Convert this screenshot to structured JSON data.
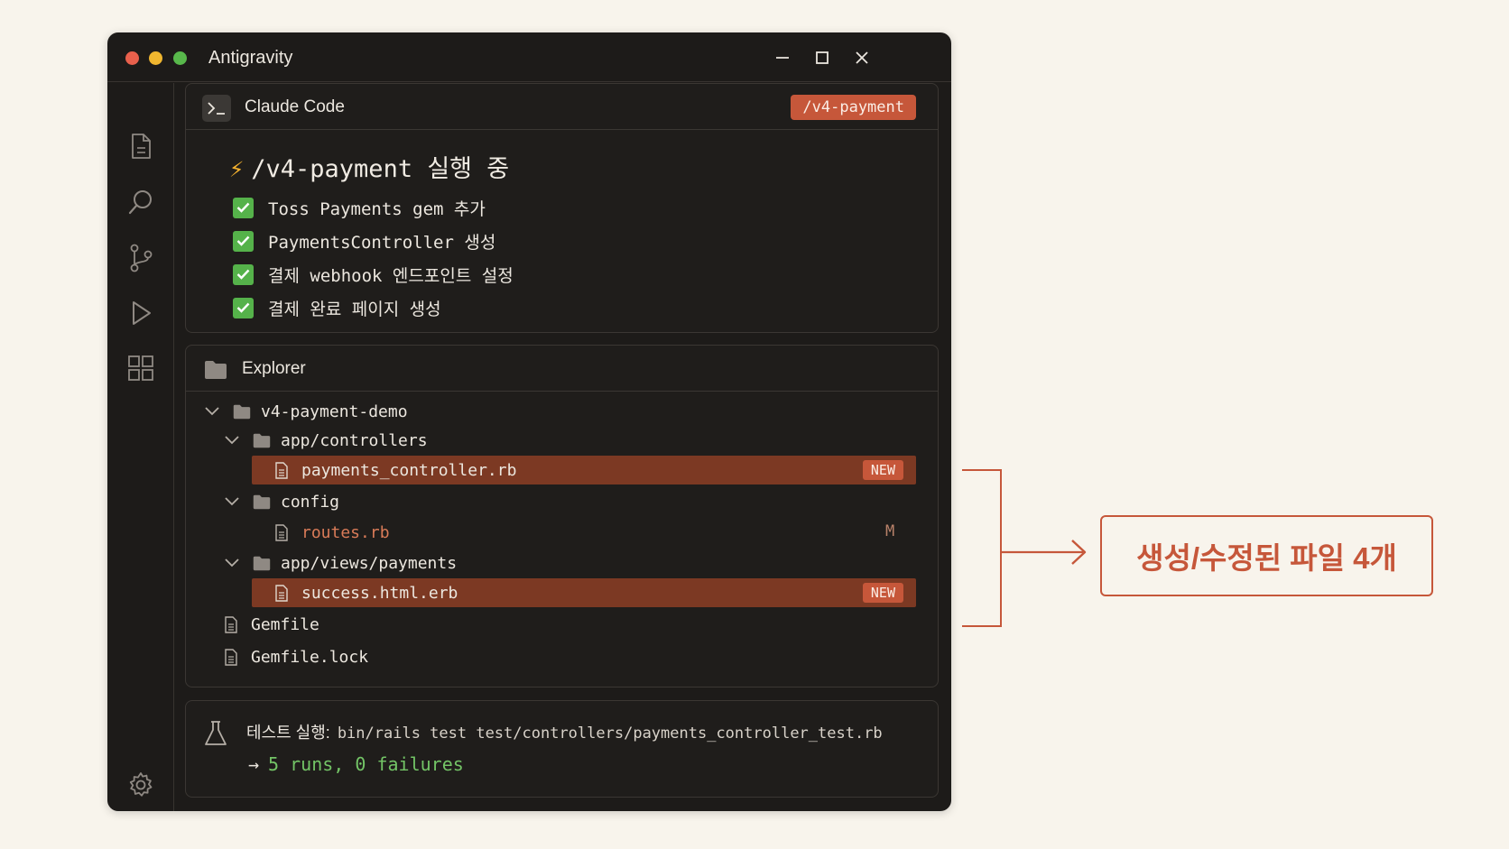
{
  "window": {
    "title": "Antigravity"
  },
  "claude_panel": {
    "title": "Claude Code",
    "tag": "/v4-payment",
    "run_title": "/v4-payment 실행 중",
    "tasks": [
      {
        "label": "Toss Payments gem 추가",
        "done": true
      },
      {
        "label": "PaymentsController 생성",
        "done": true
      },
      {
        "label": "결제 webhook 엔드포인트 설정",
        "done": true
      },
      {
        "label": "결제 완료 페이지 생성",
        "done": true
      }
    ]
  },
  "explorer": {
    "title": "Explorer",
    "tree": [
      {
        "name": "v4-payment-demo",
        "kind": "folder",
        "expanded": true
      },
      {
        "name": "app/controllers",
        "kind": "folder",
        "expanded": true
      },
      {
        "name": "payments_controller.rb",
        "kind": "file",
        "badge": "NEW",
        "highlighted": true
      },
      {
        "name": "config",
        "kind": "folder",
        "expanded": true
      },
      {
        "name": "routes.rb",
        "kind": "file",
        "status": "M",
        "modified": true
      },
      {
        "name": "app/views/payments",
        "kind": "folder",
        "expanded": true
      },
      {
        "name": "success.html.erb",
        "kind": "file",
        "badge": "NEW",
        "highlighted": true
      },
      {
        "name": "Gemfile",
        "kind": "file"
      },
      {
        "name": "Gemfile.lock",
        "kind": "file"
      }
    ]
  },
  "test_panel": {
    "label": "테스트 실행:",
    "command": "bin/rails test test/controllers/payments_controller_test.rb",
    "arrow": "→",
    "result": "5 runs, 0 failures"
  },
  "callout": {
    "text": "생성/수정된 파일 4개"
  },
  "colors": {
    "accent": "#c6573a",
    "highlight_row": "#7c3923",
    "success": "#55b24a",
    "window_bg": "#1d1b19",
    "page_bg": "#f8f4ec"
  },
  "icons": {
    "activity_bar": [
      "files-icon",
      "search-icon",
      "source-control-icon",
      "run-icon",
      "extensions-icon",
      "settings-icon"
    ],
    "window_controls": [
      "minimize-icon",
      "maximize-icon",
      "close-icon"
    ]
  }
}
